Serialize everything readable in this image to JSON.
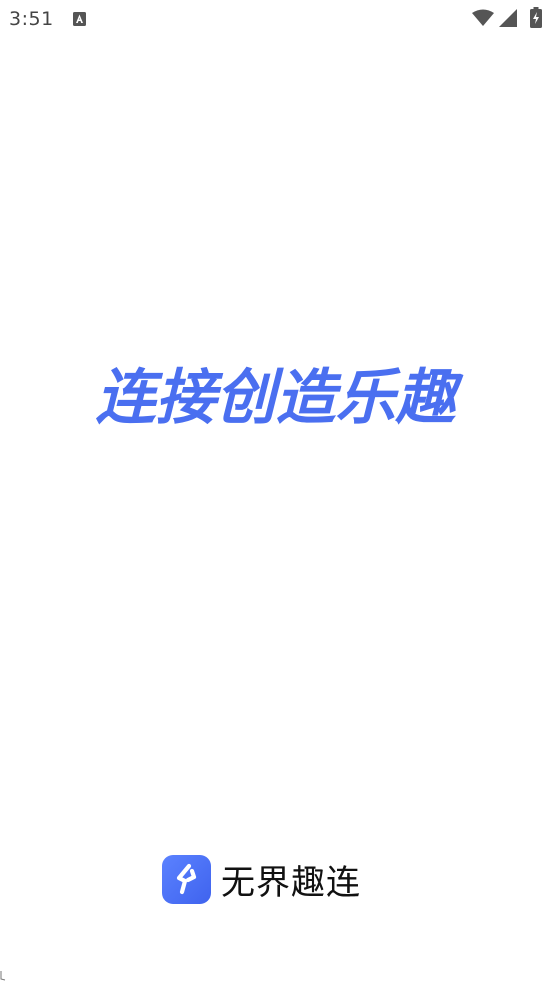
{
  "status_bar": {
    "time": "3:51",
    "icons": [
      "notification-a-icon",
      "wifi-icon",
      "signal-icon",
      "battery-charging-icon"
    ]
  },
  "splash": {
    "slogan": "连接创造乐趣"
  },
  "brand": {
    "logo_icon": "lightning-bolt-icon",
    "name": "无界趣连"
  },
  "colors": {
    "accent": "#4a6ff0",
    "brand_logo": "#4a70f5",
    "background": "#ffffff",
    "status_text": "#444444"
  }
}
